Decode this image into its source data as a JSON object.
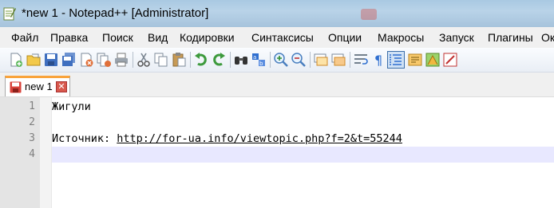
{
  "window": {
    "title": "*new 1 - Notepad++ [Administrator]"
  },
  "menu": {
    "items": [
      "Файл",
      "Правка",
      "Поиск",
      "Вид",
      "Кодировки",
      "Синтаксисы",
      "Опции",
      "Макросы",
      "Запуск",
      "Плагины",
      "Ок"
    ]
  },
  "toolbar": {
    "icons": [
      "new-file-icon",
      "open-file-icon",
      "save-icon",
      "save-all-icon",
      "close-icon",
      "close-all-icon",
      "print-icon",
      "cut-icon",
      "copy-icon",
      "paste-icon",
      "undo-icon",
      "redo-icon",
      "find-icon",
      "replace-icon",
      "zoom-in-icon",
      "zoom-out-icon",
      "sync-vertical-icon",
      "sync-horizontal-icon",
      "word-wrap-icon",
      "show-all-chars-icon",
      "indent-guide-icon",
      "udl-icon",
      "doc-map-icon",
      "function-list-icon"
    ],
    "active_icon": "indent-guide-icon"
  },
  "tabs": [
    {
      "label": "new 1",
      "modified": true
    }
  ],
  "editor": {
    "lines": [
      {
        "no": "1",
        "text": "Жигули"
      },
      {
        "no": "2",
        "text": ""
      },
      {
        "no": "3",
        "prefix": "Источник: ",
        "link": "http://for-ua.info/viewtopic.php?f=2&t=55244"
      },
      {
        "no": "4",
        "text": ""
      }
    ],
    "current_line": 4
  },
  "colors": {
    "tab_accent": "#f9a33b",
    "current_line_bg": "#e8e8ff",
    "titlebar": "#b9d3e8"
  }
}
